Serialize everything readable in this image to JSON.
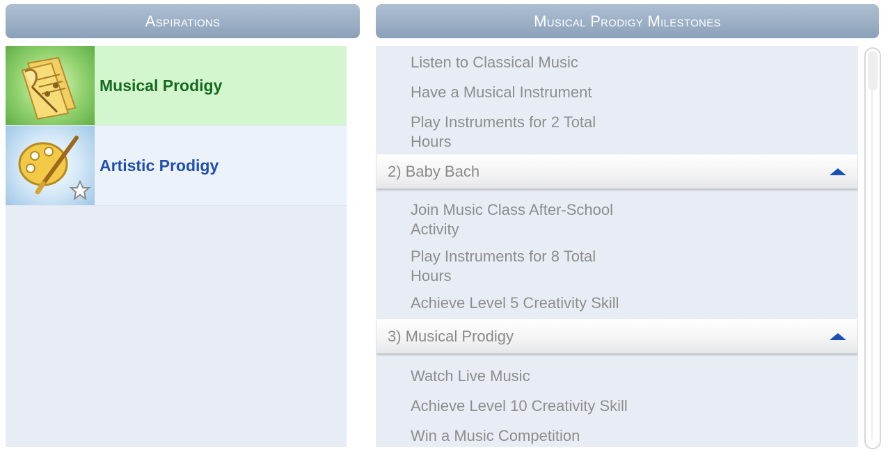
{
  "aspirations_panel": {
    "title": "Aspirations",
    "items": [
      {
        "label": "Musical Prodigy",
        "icon": "music-sheet-quill-icon",
        "selected": true
      },
      {
        "label": "Artistic Prodigy",
        "icon": "paint-palette-brush-icon",
        "selected": false
      }
    ]
  },
  "milestones_panel": {
    "title": "Musical Prodigy Milestones",
    "first_items": [
      "Listen to Classical Music",
      "Have a Musical Instrument",
      "Play Instruments for 2 Total Hours"
    ],
    "groups": [
      {
        "label": "2) Baby Bach",
        "items": [
          "Join Music Class After-School Activity",
          "Play Instruments for 8 Total Hours",
          "Achieve Level 5 Creativity Skill"
        ]
      },
      {
        "label": "3) Musical Prodigy",
        "items": [
          "Watch Live Music",
          "Achieve Level 10 Creativity Skill",
          "Win a Music Competition"
        ]
      }
    ]
  },
  "colors": {
    "header_bg": "#9fb3c8",
    "selected_row": "#d4f6cf",
    "selected_text": "#146a1e",
    "link_text": "#1f4fb0",
    "milestone_text": "#8d8d8d",
    "caret": "#1b4fb3"
  }
}
